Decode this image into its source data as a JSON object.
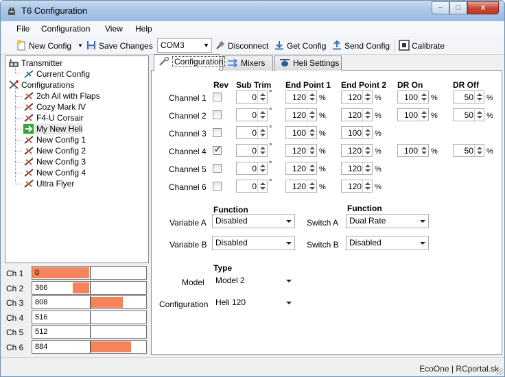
{
  "window": {
    "title": "T6 Configuration",
    "min_label": "–",
    "max_label": "□",
    "close_label": "x"
  },
  "menu": {
    "items": [
      "File",
      "Configuration",
      "View",
      "Help"
    ]
  },
  "toolbar": {
    "new_config": "New Config",
    "save_changes": "Save Changes",
    "port": "COM3",
    "disconnect": "Disconnect",
    "get_config": "Get Config",
    "send_config": "Send Config",
    "calibrate": "Calibrate"
  },
  "tree": {
    "transmitter": "Transmitter",
    "current_config": "Current Config",
    "configurations": "Configurations",
    "items": [
      "2ch Ail with Flaps",
      "Cozy Mark IV",
      "F4-U Corsair",
      "My New Heli",
      "New Config 1",
      "New Config 2",
      "New Config 3",
      "New Config 4",
      "Ultra Flyer"
    ],
    "selected": "My New Heli"
  },
  "channels": [
    {
      "label": "Ch 1",
      "value": "0",
      "level": 0
    },
    {
      "label": "Ch 2",
      "value": "366",
      "level": 366
    },
    {
      "label": "Ch 3",
      "value": "808",
      "level": 808
    },
    {
      "label": "Ch 4",
      "value": "516",
      "level": 516
    },
    {
      "label": "Ch 5",
      "value": "512",
      "level": 512
    },
    {
      "label": "Ch 6",
      "value": "884",
      "level": 884
    }
  ],
  "tabs": [
    "Configuration",
    "Mixers",
    "Heli Settings"
  ],
  "grid": {
    "headers": {
      "rev": "Rev",
      "sub_trim": "Sub Trim",
      "end_point_1": "End Point 1",
      "end_point_2": "End Point 2",
      "dr_on": "DR On",
      "dr_off": "DR Off"
    },
    "deg": "°",
    "pct": "%",
    "rows": [
      {
        "label": "Channel 1",
        "rev": false,
        "sub_trim": "0",
        "ep1": "120",
        "ep2": "120",
        "dr_on": "100",
        "dr_off": "50"
      },
      {
        "label": "Channel 2",
        "rev": false,
        "sub_trim": "0",
        "ep1": "120",
        "ep2": "120",
        "dr_on": "100",
        "dr_off": "50"
      },
      {
        "label": "Channel 3",
        "rev": false,
        "sub_trim": "0",
        "ep1": "100",
        "ep2": "100",
        "dr_on": null,
        "dr_off": null
      },
      {
        "label": "Channel 4",
        "rev": true,
        "sub_trim": "0",
        "ep1": "120",
        "ep2": "120",
        "dr_on": "100",
        "dr_off": "50"
      },
      {
        "label": "Channel 5",
        "rev": false,
        "sub_trim": "0",
        "ep1": "120",
        "ep2": "120",
        "dr_on": null,
        "dr_off": null
      },
      {
        "label": "Channel 6",
        "rev": false,
        "sub_trim": "0",
        "ep1": "120",
        "ep2": "120",
        "dr_on": null,
        "dr_off": null
      }
    ]
  },
  "variables": {
    "function_header": "Function",
    "variable_a_label": "Variable A",
    "variable_a": "Disabled",
    "variable_b_label": "Variable B",
    "variable_b": "Disabled",
    "switch_function_header": "Function",
    "switch_a_label": "Switch A",
    "switch_a": "Dual Rate",
    "switch_b_label": "Switch B",
    "switch_b": "Disabled"
  },
  "model": {
    "type_header": "Type",
    "model_label": "Model",
    "model_value": "Model 2",
    "configuration_label": "Configuration",
    "configuration_value": "Heli 120"
  },
  "status": {
    "text": "EcoOne | RCportal.sk"
  }
}
